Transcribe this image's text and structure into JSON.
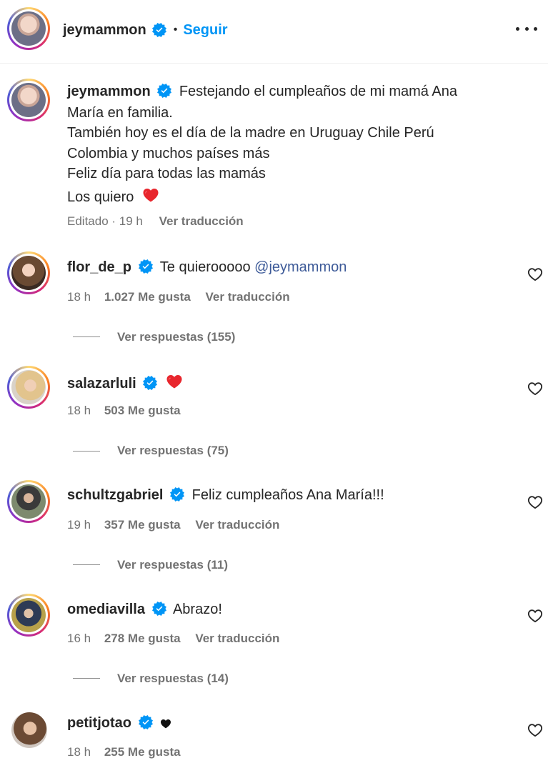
{
  "header": {
    "username": "jeymammon",
    "separator": "•",
    "follow_label": "Seguir",
    "more_label": "•••"
  },
  "caption": {
    "username": "jeymammon",
    "line1": "Festejando el cumpleaños de mi mamá Ana",
    "line2": "María en familia.",
    "line3": "También hoy es el día de la madre en Uruguay Chile Perú",
    "line4": "Colombia y muchos países más",
    "line5": "Feliz día para todas las mamás",
    "line6": "Los quiero",
    "edited": "Editado · 19 h",
    "translate": "Ver traducción"
  },
  "comments": [
    {
      "username": "flor_de_p",
      "text": "Te quierooooo",
      "mention": "@jeymammon",
      "time": "18 h",
      "likes": "1.027 Me gusta",
      "translate": "Ver traducción",
      "replies": "Ver respuestas (155)"
    },
    {
      "username": "salazarluli",
      "time": "18 h",
      "likes": "503 Me gusta",
      "replies": "Ver respuestas (75)"
    },
    {
      "username": "schultzgabriel",
      "text": "Feliz cumpleaños Ana María!!!",
      "time": "19 h",
      "likes": "357 Me gusta",
      "translate": "Ver traducción",
      "replies": "Ver respuestas (11)"
    },
    {
      "username": "omediavilla",
      "text": "Abrazo!",
      "time": "16 h",
      "likes": "278 Me gusta",
      "translate": "Ver traducción",
      "replies": "Ver respuestas (14)"
    },
    {
      "username": "petitjotao",
      "time": "18 h",
      "likes": "255 Me gusta"
    }
  ],
  "icons": {
    "verified": "verified-badge-icon",
    "heart_outline": "heart-outline-icon",
    "red_heart_emoji": "red-heart-emoji",
    "black_heart": "black-heart-icon"
  },
  "colors": {
    "verified": "#0095f6",
    "follow": "#0095f6",
    "mention": "#3d5a98",
    "red_heart": "#e8262d"
  }
}
